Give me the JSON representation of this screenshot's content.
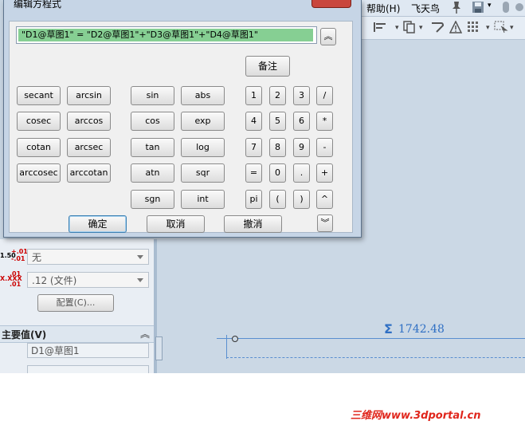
{
  "dialog": {
    "title": "编辑方程式",
    "equation": "\"D1@草图1\" = \"D2@草图1\"+\"D3@草图1\"+\"D4@草图1\"",
    "expand_up": "︽",
    "expand_down": "︾",
    "note_button": "备注",
    "func_buttons": [
      "secant",
      "arcsin",
      "sin",
      "abs",
      "cosec",
      "arccos",
      "cos",
      "exp",
      "cotan",
      "arcsec",
      "tan",
      "log",
      "arccosec",
      "arccotan",
      "atn",
      "sqr",
      "sgn",
      "int"
    ],
    "key_buttons": [
      "1",
      "2",
      "3",
      "/",
      "4",
      "5",
      "6",
      "*",
      "7",
      "8",
      "9",
      "-",
      "=",
      "0",
      ".",
      "+",
      "pi",
      "(",
      ")",
      "^"
    ],
    "ok_button": "确定",
    "cancel_button": "取消",
    "undo_button": "撤消"
  },
  "menu": {
    "help": "帮助(H)",
    "feitianniao": "飞天鸟"
  },
  "toolbar": {
    "icons": [
      "align-icon",
      "copy-icon",
      "curve-icon",
      "warning-icon",
      "grid-icon",
      "select-icon"
    ]
  },
  "panel": {
    "tol_top": "+.01",
    "tol_mid": "1.50",
    "tol_bot": "-.01",
    "combo1": "无",
    "combo2": ".12 (文件)",
    "config_button": "配置(C)...",
    "section_title": "主要值(V)",
    "primary_value": "D1@草图1",
    "xxx_label": "X.XXX"
  },
  "canvas": {
    "dimension": "1742.48",
    "sigma": "Σ"
  },
  "watermark": "三维网www.3dportal.cn"
}
